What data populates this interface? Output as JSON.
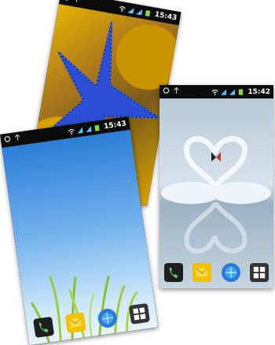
{
  "phones": [
    {
      "time": "15:43"
    },
    {
      "time": "15:42"
    },
    {
      "time": "15:43"
    }
  ],
  "colors": {
    "statusbar": "#0b0b0b",
    "sky_top": "#2c7ed6",
    "sky_bottom": "#cfe8fb",
    "starfish": "#2a4fd6",
    "coral": "#e0a900",
    "swan_bg": "#9fb6c9"
  },
  "dock_icons": [
    "phone-icon",
    "mail-icon",
    "browser-globe-icon",
    "apps-grid-icon"
  ]
}
